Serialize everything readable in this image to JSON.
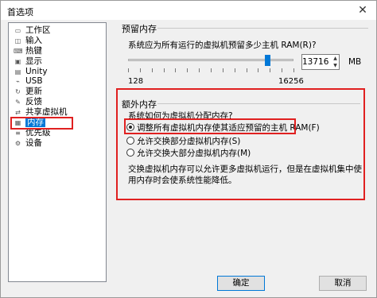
{
  "window": {
    "title": "首选项",
    "close_glyph": "✕"
  },
  "sidebar": {
    "items": [
      {
        "label": "工作区",
        "icon": "workspace-icon",
        "glyph": "▭"
      },
      {
        "label": "输入",
        "icon": "input-icon",
        "glyph": "◫"
      },
      {
        "label": "热键",
        "icon": "hotkey-icon",
        "glyph": "⌨"
      },
      {
        "label": "显示",
        "icon": "display-icon",
        "glyph": "▣"
      },
      {
        "label": "Unity",
        "icon": "unity-icon",
        "glyph": "▤"
      },
      {
        "label": "USB",
        "icon": "usb-icon",
        "glyph": "⌁"
      },
      {
        "label": "更新",
        "icon": "update-icon",
        "glyph": "↻"
      },
      {
        "label": "反馈",
        "icon": "feedback-icon",
        "glyph": "✎"
      },
      {
        "label": "共享虚拟机",
        "icon": "shared-vm-icon",
        "glyph": "⇄"
      },
      {
        "label": "内存",
        "icon": "memory-icon",
        "glyph": "▦",
        "selected": true
      },
      {
        "label": "优先级",
        "icon": "priority-icon",
        "glyph": "≡"
      },
      {
        "label": "设备",
        "icon": "device-icon",
        "glyph": "⚙"
      }
    ]
  },
  "reserved": {
    "group_title": "预留内存",
    "prompt": "系统应为所有运行的虚拟机预留多少主机 RAM(R)?",
    "value_mb": 13716,
    "value_text": "13716",
    "unit": "MB",
    "min_label": "128",
    "max_label": "16256",
    "slider_min": 128,
    "slider_max": 16256
  },
  "extra": {
    "group_title": "额外内存",
    "prompt": "系统如何为虚拟机分配内存?",
    "options": [
      {
        "label": "调整所有虚拟机内存使其适应预留的主机 RAM(F)",
        "checked": true
      },
      {
        "label": "允许交换部分虚拟机内存(S)",
        "checked": false
      },
      {
        "label": "允许交换大部分虚拟机内存(M)",
        "checked": false
      }
    ],
    "description": "交换虚拟机内存可以允许更多虚拟机运行，但是在虚拟机集中使用内存时会使系统性能降低。"
  },
  "buttons": {
    "ok": "确定",
    "cancel": "取消"
  },
  "colors": {
    "accent": "#0078d7",
    "highlight": "#e02020"
  }
}
